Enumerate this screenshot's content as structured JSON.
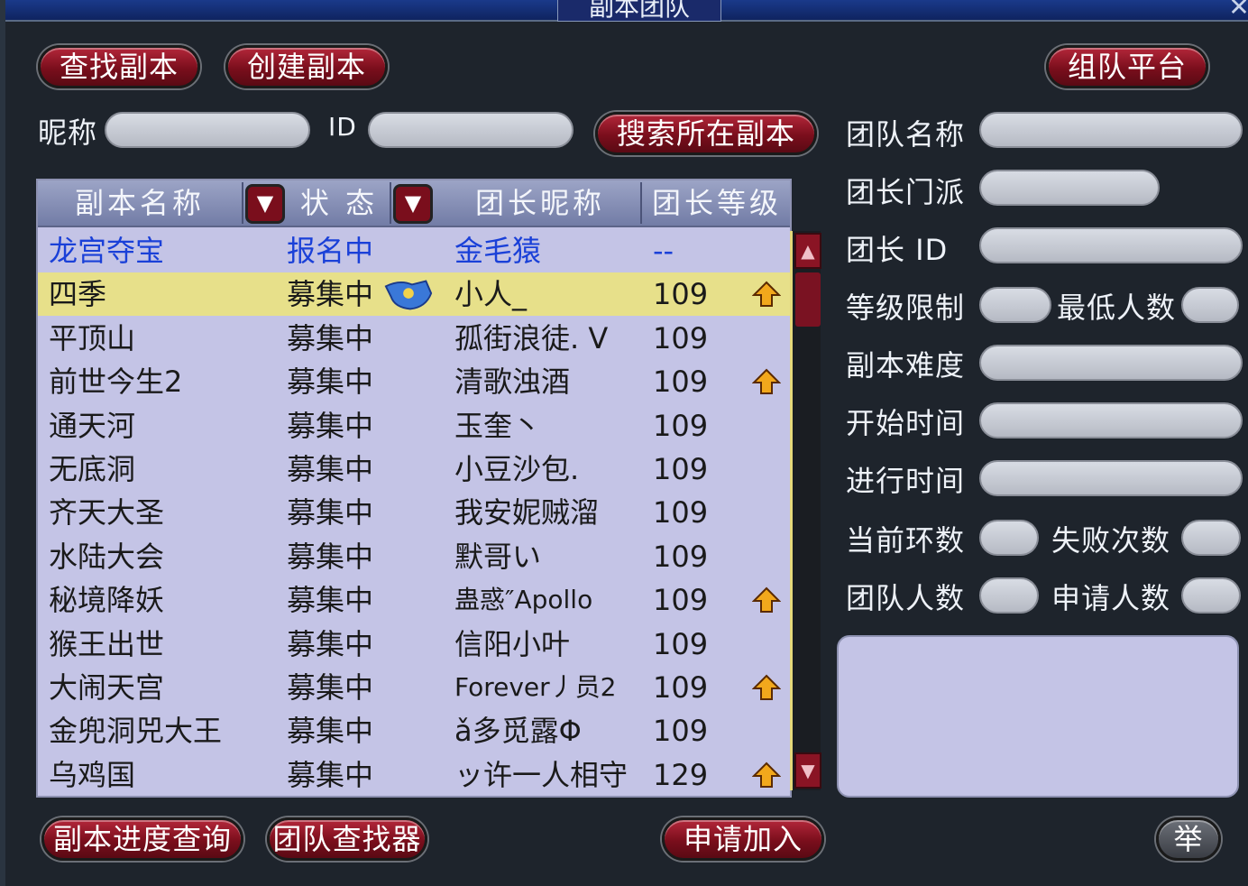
{
  "window": {
    "title": "副本团队",
    "close": "✕"
  },
  "top_buttons": {
    "find": "查找副本",
    "create": "创建副本",
    "team_platform": "组队平台"
  },
  "search": {
    "nickname_label": "昵称",
    "id_label": "ID",
    "search_button": "搜索所在副本"
  },
  "table": {
    "columns": [
      "副本名称",
      "状 态",
      "团长昵称",
      "团长等级"
    ],
    "sort_icon": "▼",
    "rows": [
      {
        "name": "龙宫夺宝",
        "status": "报名中",
        "leader": "金毛猿",
        "level": "--",
        "up": false
      },
      {
        "name": "四季",
        "status": "募集中",
        "leader": "小人_",
        "level": "109",
        "up": true
      },
      {
        "name": "平顶山",
        "status": "募集中",
        "leader": "孤街浪徒. V",
        "level": "109",
        "up": false
      },
      {
        "name": "前世今生2",
        "status": "募集中",
        "leader": "清歌浊酒",
        "level": "109",
        "up": true
      },
      {
        "name": "通天河",
        "status": "募集中",
        "leader": "玉奎丶",
        "level": "109",
        "up": false
      },
      {
        "name": "无底洞",
        "status": "募集中",
        "leader": "小豆沙包.",
        "level": "109",
        "up": false
      },
      {
        "name": "齐天大圣",
        "status": "募集中",
        "leader": "我安妮贼溜",
        "level": "109",
        "up": false
      },
      {
        "name": "水陆大会",
        "status": "募集中",
        "leader": "默哥い",
        "level": "109",
        "up": false
      },
      {
        "name": "秘境降妖",
        "status": "募集中",
        "leader": "蛊惑″Apollo",
        "level": "109",
        "up": true
      },
      {
        "name": "猴王出世",
        "status": "募集中",
        "leader": "信阳小叶",
        "level": "109",
        "up": false
      },
      {
        "name": "大闹天宫",
        "status": "募集中",
        "leader": "Forever丿员2",
        "level": "109",
        "up": true
      },
      {
        "name": "金兜洞兕大王",
        "status": "募集中",
        "leader": "ǎ多觅露Φ",
        "level": "109",
        "up": false
      },
      {
        "name": "乌鸡国",
        "status": "募集中",
        "leader": "ッ许一人相守",
        "level": "129",
        "up": true
      }
    ],
    "selected_index": 1
  },
  "details": {
    "team_name": "团队名称",
    "leader_school": "团长门派",
    "leader_id": "团长 ID",
    "level_limit": "等级限制",
    "min_members": "最低人数",
    "difficulty": "副本难度",
    "start_time": "开始时间",
    "elapsed_time": "进行时间",
    "current_round": "当前环数",
    "fail_count": "失败次数",
    "team_size": "团队人数",
    "applicants": "申请人数"
  },
  "bottom_buttons": {
    "progress": "副本进度查询",
    "finder": "团队查找器",
    "apply": "申请加入",
    "report": "举"
  },
  "colors": {
    "button_red": "#7a0e1c",
    "table_bg": "#c4c4e6",
    "selected_row": "#e7e08a",
    "link_blue": "#1a40d8"
  }
}
